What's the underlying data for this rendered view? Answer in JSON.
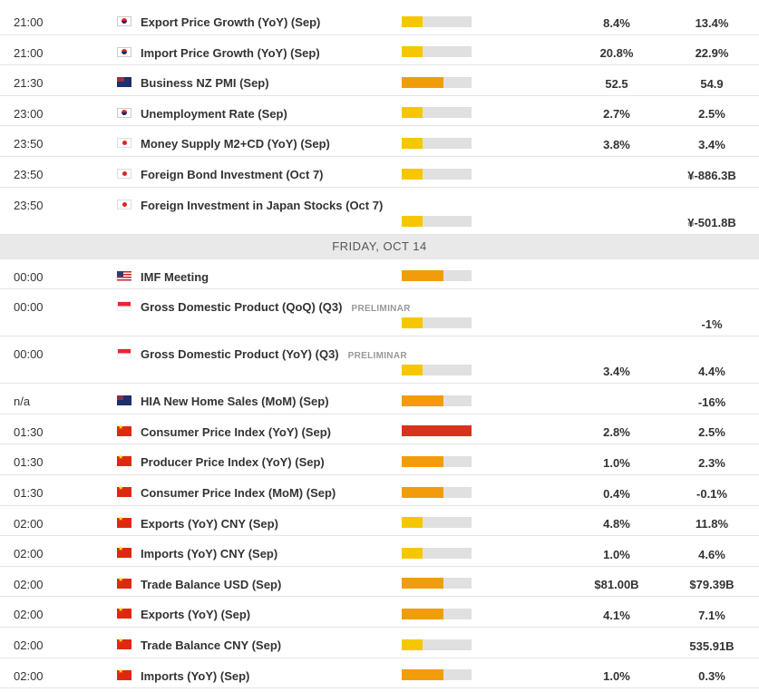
{
  "day_header": "FRIDAY, OCT 14",
  "rows_before": [
    {
      "time": "21:00",
      "flag": "kr",
      "event": "Export Price Growth (YoY) (Sep)",
      "tag": "",
      "impact": "low",
      "actual": "8.4%",
      "previous": "13.4%",
      "tall": false
    },
    {
      "time": "21:00",
      "flag": "kr",
      "event": "Import Price Growth (YoY) (Sep)",
      "tag": "",
      "impact": "low",
      "actual": "20.8%",
      "previous": "22.9%",
      "tall": false
    },
    {
      "time": "21:30",
      "flag": "nz",
      "event": "Business NZ PMI (Sep)",
      "tag": "",
      "impact": "med",
      "actual": "52.5",
      "previous": "54.9",
      "tall": false
    },
    {
      "time": "23:00",
      "flag": "kr",
      "event": "Unemployment Rate (Sep)",
      "tag": "",
      "impact": "low",
      "actual": "2.7%",
      "previous": "2.5%",
      "tall": false
    },
    {
      "time": "23:50",
      "flag": "jp",
      "event": "Money Supply M2+CD (YoY) (Sep)",
      "tag": "",
      "impact": "low",
      "actual": "3.8%",
      "previous": "3.4%",
      "tall": false
    },
    {
      "time": "23:50",
      "flag": "jp",
      "event": "Foreign Bond Investment (Oct 7)",
      "tag": "",
      "impact": "low",
      "actual": "",
      "previous": "¥-886.3B",
      "tall": false
    },
    {
      "time": "23:50",
      "flag": "jp",
      "event": "Foreign Investment in Japan Stocks (Oct 7)",
      "tag": "",
      "impact": "low",
      "actual": "",
      "previous": "¥-501.8B",
      "tall": true
    }
  ],
  "rows_after": [
    {
      "time": "00:00",
      "flag": "us",
      "event": "IMF Meeting",
      "tag": "",
      "impact": "med",
      "actual": "",
      "previous": "",
      "tall": false
    },
    {
      "time": "00:00",
      "flag": "sg",
      "event": "Gross Domestic Product (QoQ) (Q3)",
      "tag": "PRELIMINAR",
      "impact": "low",
      "actual": "",
      "previous": "-1%",
      "tall": true
    },
    {
      "time": "00:00",
      "flag": "sg",
      "event": "Gross Domestic Product (YoY) (Q3)",
      "tag": "PRELIMINAR",
      "impact": "low",
      "actual": "3.4%",
      "previous": "4.4%",
      "tall": true
    },
    {
      "time": "n/a",
      "flag": "au",
      "event": "HIA New Home Sales (MoM) (Sep)",
      "tag": "",
      "impact": "med",
      "actual": "",
      "previous": "-16%",
      "tall": false
    },
    {
      "time": "01:30",
      "flag": "cn",
      "event": "Consumer Price Index (YoY) (Sep)",
      "tag": "",
      "impact": "high",
      "actual": "2.8%",
      "previous": "2.5%",
      "tall": false
    },
    {
      "time": "01:30",
      "flag": "cn",
      "event": "Producer Price Index (YoY) (Sep)",
      "tag": "",
      "impact": "med",
      "actual": "1.0%",
      "previous": "2.3%",
      "tall": false
    },
    {
      "time": "01:30",
      "flag": "cn",
      "event": "Consumer Price Index (MoM) (Sep)",
      "tag": "",
      "impact": "med",
      "actual": "0.4%",
      "previous": "-0.1%",
      "tall": false
    },
    {
      "time": "02:00",
      "flag": "cn",
      "event": "Exports (YoY) CNY (Sep)",
      "tag": "",
      "impact": "low",
      "actual": "4.8%",
      "previous": "11.8%",
      "tall": false
    },
    {
      "time": "02:00",
      "flag": "cn",
      "event": "Imports (YoY) CNY (Sep)",
      "tag": "",
      "impact": "low",
      "actual": "1.0%",
      "previous": "4.6%",
      "tall": false
    },
    {
      "time": "02:00",
      "flag": "cn",
      "event": "Trade Balance USD (Sep)",
      "tag": "",
      "impact": "med",
      "actual": "$81.00B",
      "previous": "$79.39B",
      "tall": false
    },
    {
      "time": "02:00",
      "flag": "cn",
      "event": "Exports (YoY) (Sep)",
      "tag": "",
      "impact": "med",
      "actual": "4.1%",
      "previous": "7.1%",
      "tall": false
    },
    {
      "time": "02:00",
      "flag": "cn",
      "event": "Trade Balance CNY (Sep)",
      "tag": "",
      "impact": "low",
      "actual": "",
      "previous": "535.91B",
      "tall": false
    },
    {
      "time": "02:00",
      "flag": "cn",
      "event": "Imports (YoY) (Sep)",
      "tag": "",
      "impact": "med",
      "actual": "1.0%",
      "previous": "0.3%",
      "tall": false
    }
  ]
}
